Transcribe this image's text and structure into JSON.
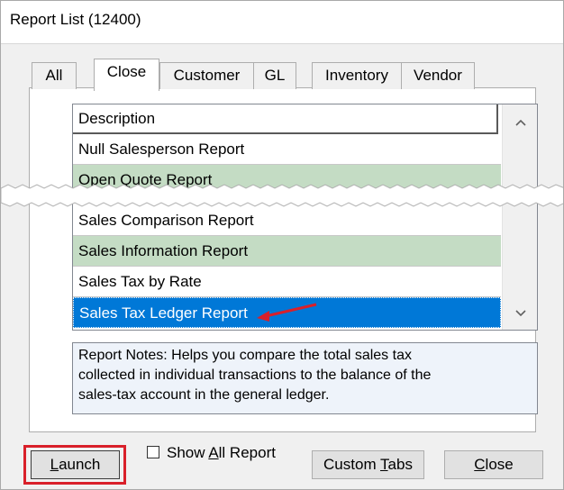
{
  "window": {
    "title": "Report List (12400)"
  },
  "tabs": [
    {
      "label": "All",
      "active": false
    },
    {
      "label": "Close",
      "active": true
    },
    {
      "label": "Customer",
      "active": false
    },
    {
      "label": "GL",
      "active": false
    },
    {
      "label": "Inventory",
      "active": false
    },
    {
      "label": "Vendor",
      "active": false
    }
  ],
  "list": {
    "header": "Description",
    "rows": [
      {
        "label": "Null Salesperson Report",
        "style": "white"
      },
      {
        "label": "Open Quote Report",
        "style": "green"
      },
      {
        "label": "Sales Comparison Report",
        "style": "white"
      },
      {
        "label": "Sales Information Report",
        "style": "green"
      },
      {
        "label": "Sales Tax by Rate",
        "style": "white"
      },
      {
        "label": "Sales Tax Ledger Report",
        "style": "selected"
      }
    ]
  },
  "scrollbar": {
    "up_icon": "chevron-up-icon",
    "down_icon": "chevron-down-icon"
  },
  "notes": {
    "line1": "Report Notes:  Helps you compare the total sales tax",
    "line2": "collected in individual transactions to the balance of the",
    "line3": "sales-tax account in the general ledger."
  },
  "buttons": {
    "launch_underlined": "L",
    "launch_rest": "aunch",
    "custom_tabs_pre": "Custom ",
    "custom_tabs_underlined": "T",
    "custom_tabs_post": "abs",
    "close_underlined": "C",
    "close_rest": "lose"
  },
  "checkbox": {
    "label_pre": "Show ",
    "label_underlined": "A",
    "label_post": "ll Report",
    "checked": false
  },
  "colors": {
    "selection": "#0078d7",
    "alt_row": "#c4dcc4",
    "highlight_frame": "#d9202a",
    "arrow": "#d9202a"
  }
}
